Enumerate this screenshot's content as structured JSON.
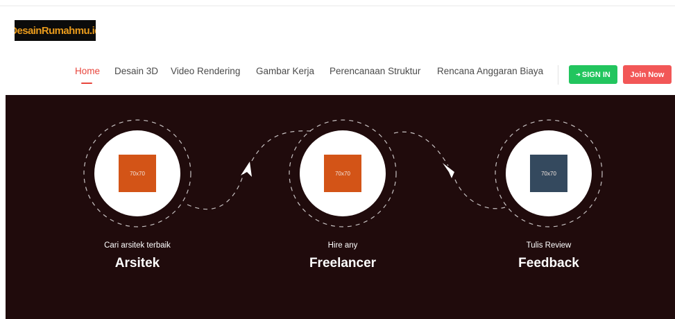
{
  "logo": {
    "text": "DesainRumahmu.id"
  },
  "nav": {
    "items": [
      {
        "label": "Home",
        "active": true
      },
      {
        "label": "Desain 3D",
        "active": false
      },
      {
        "label": "Video Rendering",
        "active": false
      },
      {
        "label": "Gambar Kerja",
        "active": false
      },
      {
        "label": "Perencanaan Struktur",
        "active": false
      },
      {
        "label": "Rencana Anggaran Biaya",
        "active": false
      }
    ],
    "signin_label": "SIGN IN",
    "signin_icon": "sign-in-icon",
    "join_label": "Join Now"
  },
  "steps": [
    {
      "placeholder": "70x70",
      "color": "#d35417",
      "subtitle": "Cari arsitek terbaik",
      "title": "Arsitek"
    },
    {
      "placeholder": "70x70",
      "color": "#d35417",
      "subtitle": "Hire any",
      "title": "Freelancer"
    },
    {
      "placeholder": "70x70",
      "color": "#34495e",
      "subtitle": "Tulis Review",
      "title": "Feedback"
    }
  ],
  "colors": {
    "accent": "#e8453c",
    "signin": "#22c55e",
    "join": "#f25757",
    "hero_bg": "#200b0c"
  }
}
